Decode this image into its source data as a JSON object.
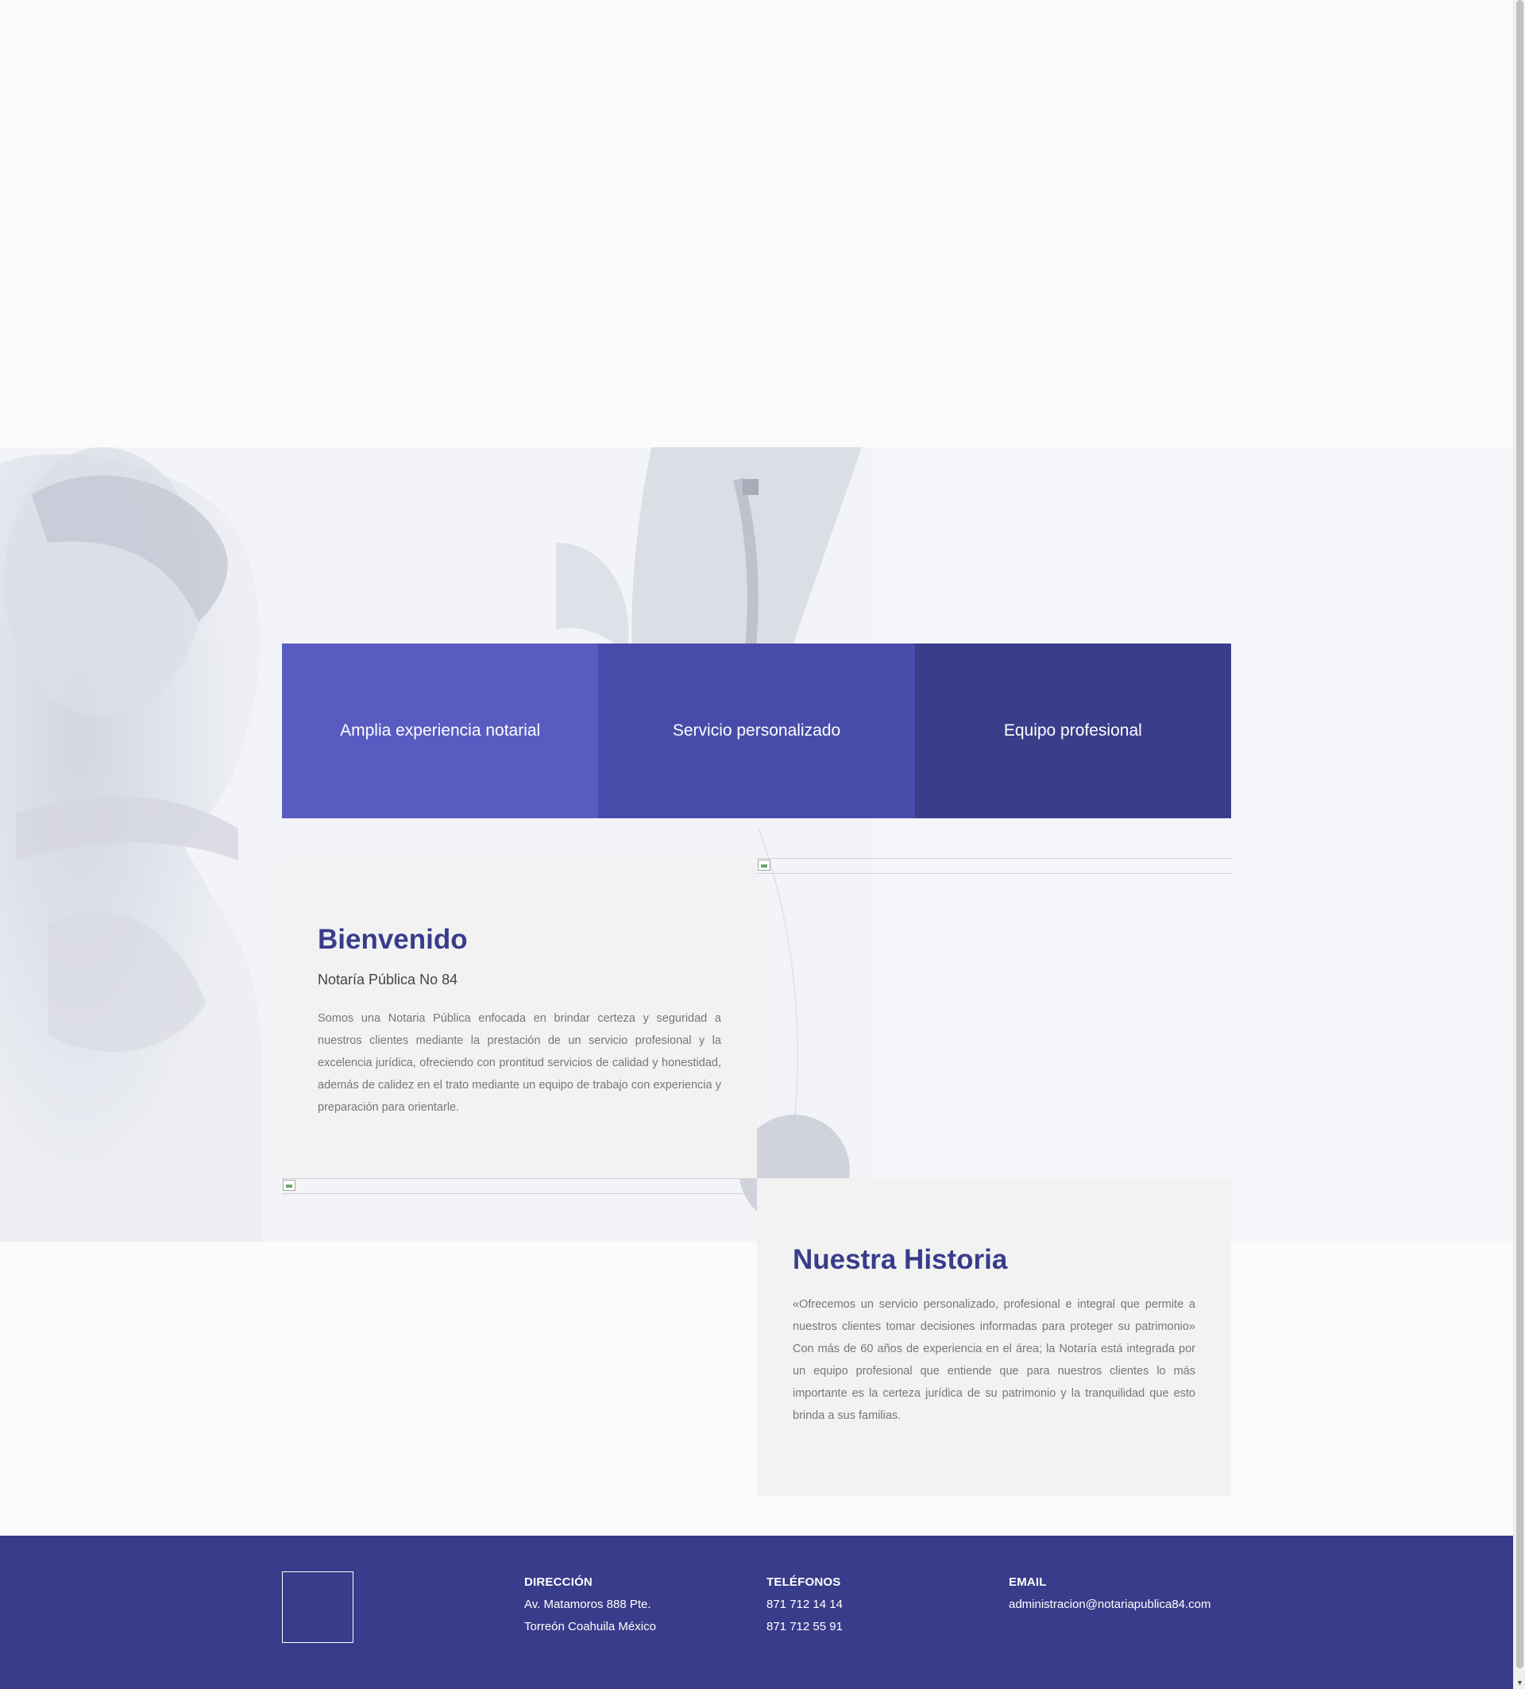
{
  "features": [
    {
      "label": "Amplia experiencia notarial"
    },
    {
      "label": "Servicio personalizado"
    },
    {
      "label": "Equipo profesional"
    }
  ],
  "welcome": {
    "title": "Bienvenido",
    "subtitle": "Notaría Pública No 84",
    "body": "Somos una Notaria Pública enfocada en brindar certeza y seguridad a nuestros clientes mediante la prestación de un servicio profesional y la excelencia jurídica, ofreciendo con prontitud servicios de calidad y honestidad, además de calidez en el trato mediante un equipo de trabajo con experiencia y preparación para orientarle."
  },
  "history": {
    "title": "Nuestra Historia",
    "body": "«Ofrecemos un servicio personalizado, profesional e integral que permite a nuestros clientes tomar decisiones informadas para proteger su patrimonio» Con más de 60 años de experiencia en el área; la Notaría está integrada por un equipo profesional que entiende que para nuestros clientes lo más importante es la certeza jurídica de su patrimonio y la tranquilidad que esto brinda a sus familias."
  },
  "footer": {
    "address": {
      "heading": "DIRECCIÓN",
      "line1": "Av. Matamoros 888 Pte.",
      "line2": "Torreón Coahuila México"
    },
    "phones": {
      "heading": "TELÉFONOS",
      "line1": "871 712 14 14",
      "line2": "871 712 55 91"
    },
    "email": {
      "heading": "EMAIL",
      "line1": "administracion@notariapublica84.com"
    }
  },
  "colors": {
    "brand_dark": "#393c8a",
    "brand_mid": "#474caa",
    "brand_light": "#585cc1",
    "card_bg": "#f2f2f2"
  }
}
